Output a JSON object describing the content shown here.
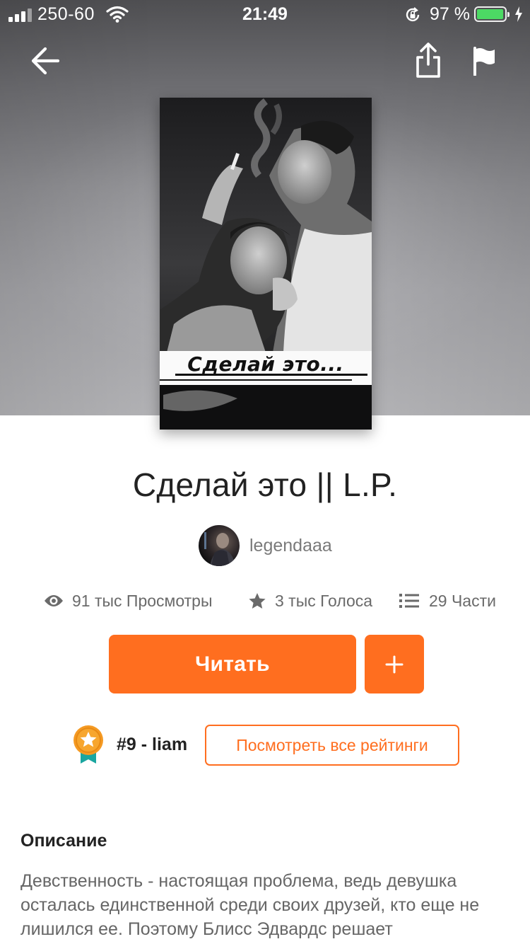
{
  "status_bar": {
    "carrier": "250-60",
    "time": "21:49",
    "battery_percent": "97 %",
    "battery_level": 0.97
  },
  "nav": {
    "back_icon": "arrow-left-icon",
    "share_icon": "share-icon",
    "report_icon": "flag-icon"
  },
  "cover": {
    "title": "Сделай это..."
  },
  "story": {
    "title": "Сделай это || L.P.",
    "author": "legendaaa"
  },
  "stats": {
    "views": "91 тыс Просмотры",
    "votes": "3 тыс Голоса",
    "parts": "29 Части"
  },
  "actions": {
    "read_label": "Читать",
    "add_label": "+"
  },
  "ranking": {
    "rank_label": "#9 - liam",
    "all_ratings_label": "Посмотреть все рейтинги"
  },
  "description": {
    "heading": "Описание",
    "text": "Девственность - настоящая проблема, ведь девушка осталась единственной среди своих друзей, кто еще не лишился ее. Поэтому Блисс Эдвардс решает"
  },
  "colors": {
    "accent": "#ff6e1f",
    "battery": "#4cd964"
  }
}
